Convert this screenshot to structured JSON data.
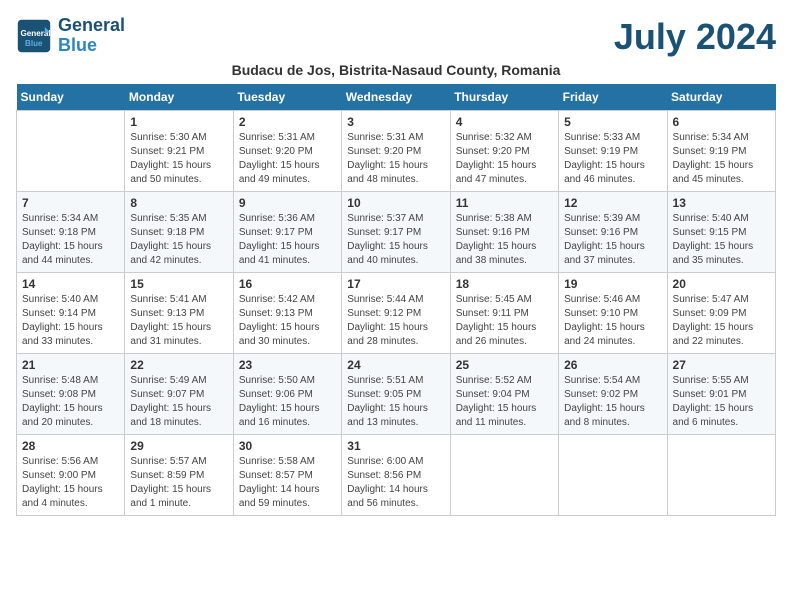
{
  "logo": {
    "text_general": "General",
    "text_blue": "Blue"
  },
  "header": {
    "month": "July 2024",
    "location": "Budacu de Jos, Bistrita-Nasaud County, Romania"
  },
  "weekdays": [
    "Sunday",
    "Monday",
    "Tuesday",
    "Wednesday",
    "Thursday",
    "Friday",
    "Saturday"
  ],
  "weeks": [
    [
      {
        "day": "",
        "info": ""
      },
      {
        "day": "1",
        "info": "Sunrise: 5:30 AM\nSunset: 9:21 PM\nDaylight: 15 hours\nand 50 minutes."
      },
      {
        "day": "2",
        "info": "Sunrise: 5:31 AM\nSunset: 9:20 PM\nDaylight: 15 hours\nand 49 minutes."
      },
      {
        "day": "3",
        "info": "Sunrise: 5:31 AM\nSunset: 9:20 PM\nDaylight: 15 hours\nand 48 minutes."
      },
      {
        "day": "4",
        "info": "Sunrise: 5:32 AM\nSunset: 9:20 PM\nDaylight: 15 hours\nand 47 minutes."
      },
      {
        "day": "5",
        "info": "Sunrise: 5:33 AM\nSunset: 9:19 PM\nDaylight: 15 hours\nand 46 minutes."
      },
      {
        "day": "6",
        "info": "Sunrise: 5:34 AM\nSunset: 9:19 PM\nDaylight: 15 hours\nand 45 minutes."
      }
    ],
    [
      {
        "day": "7",
        "info": "Sunrise: 5:34 AM\nSunset: 9:18 PM\nDaylight: 15 hours\nand 44 minutes."
      },
      {
        "day": "8",
        "info": "Sunrise: 5:35 AM\nSunset: 9:18 PM\nDaylight: 15 hours\nand 42 minutes."
      },
      {
        "day": "9",
        "info": "Sunrise: 5:36 AM\nSunset: 9:17 PM\nDaylight: 15 hours\nand 41 minutes."
      },
      {
        "day": "10",
        "info": "Sunrise: 5:37 AM\nSunset: 9:17 PM\nDaylight: 15 hours\nand 40 minutes."
      },
      {
        "day": "11",
        "info": "Sunrise: 5:38 AM\nSunset: 9:16 PM\nDaylight: 15 hours\nand 38 minutes."
      },
      {
        "day": "12",
        "info": "Sunrise: 5:39 AM\nSunset: 9:16 PM\nDaylight: 15 hours\nand 37 minutes."
      },
      {
        "day": "13",
        "info": "Sunrise: 5:40 AM\nSunset: 9:15 PM\nDaylight: 15 hours\nand 35 minutes."
      }
    ],
    [
      {
        "day": "14",
        "info": "Sunrise: 5:40 AM\nSunset: 9:14 PM\nDaylight: 15 hours\nand 33 minutes."
      },
      {
        "day": "15",
        "info": "Sunrise: 5:41 AM\nSunset: 9:13 PM\nDaylight: 15 hours\nand 31 minutes."
      },
      {
        "day": "16",
        "info": "Sunrise: 5:42 AM\nSunset: 9:13 PM\nDaylight: 15 hours\nand 30 minutes."
      },
      {
        "day": "17",
        "info": "Sunrise: 5:44 AM\nSunset: 9:12 PM\nDaylight: 15 hours\nand 28 minutes."
      },
      {
        "day": "18",
        "info": "Sunrise: 5:45 AM\nSunset: 9:11 PM\nDaylight: 15 hours\nand 26 minutes."
      },
      {
        "day": "19",
        "info": "Sunrise: 5:46 AM\nSunset: 9:10 PM\nDaylight: 15 hours\nand 24 minutes."
      },
      {
        "day": "20",
        "info": "Sunrise: 5:47 AM\nSunset: 9:09 PM\nDaylight: 15 hours\nand 22 minutes."
      }
    ],
    [
      {
        "day": "21",
        "info": "Sunrise: 5:48 AM\nSunset: 9:08 PM\nDaylight: 15 hours\nand 20 minutes."
      },
      {
        "day": "22",
        "info": "Sunrise: 5:49 AM\nSunset: 9:07 PM\nDaylight: 15 hours\nand 18 minutes."
      },
      {
        "day": "23",
        "info": "Sunrise: 5:50 AM\nSunset: 9:06 PM\nDaylight: 15 hours\nand 16 minutes."
      },
      {
        "day": "24",
        "info": "Sunrise: 5:51 AM\nSunset: 9:05 PM\nDaylight: 15 hours\nand 13 minutes."
      },
      {
        "day": "25",
        "info": "Sunrise: 5:52 AM\nSunset: 9:04 PM\nDaylight: 15 hours\nand 11 minutes."
      },
      {
        "day": "26",
        "info": "Sunrise: 5:54 AM\nSunset: 9:02 PM\nDaylight: 15 hours\nand 8 minutes."
      },
      {
        "day": "27",
        "info": "Sunrise: 5:55 AM\nSunset: 9:01 PM\nDaylight: 15 hours\nand 6 minutes."
      }
    ],
    [
      {
        "day": "28",
        "info": "Sunrise: 5:56 AM\nSunset: 9:00 PM\nDaylight: 15 hours\nand 4 minutes."
      },
      {
        "day": "29",
        "info": "Sunrise: 5:57 AM\nSunset: 8:59 PM\nDaylight: 15 hours\nand 1 minute."
      },
      {
        "day": "30",
        "info": "Sunrise: 5:58 AM\nSunset: 8:57 PM\nDaylight: 14 hours\nand 59 minutes."
      },
      {
        "day": "31",
        "info": "Sunrise: 6:00 AM\nSunset: 8:56 PM\nDaylight: 14 hours\nand 56 minutes."
      },
      {
        "day": "",
        "info": ""
      },
      {
        "day": "",
        "info": ""
      },
      {
        "day": "",
        "info": ""
      }
    ]
  ]
}
